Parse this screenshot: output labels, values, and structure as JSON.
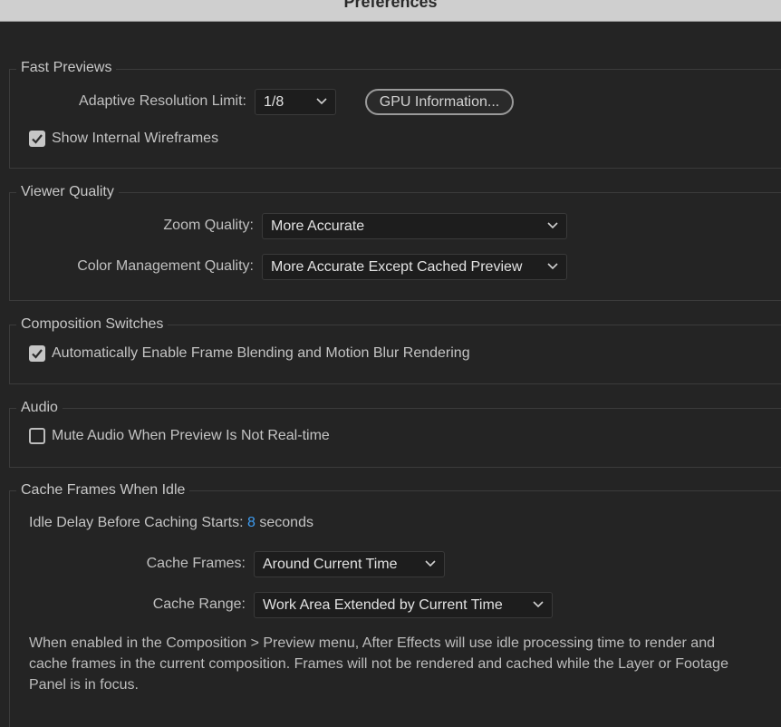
{
  "window": {
    "title": "Preferences"
  },
  "fast_previews": {
    "heading": "Fast Previews",
    "adaptive_label": "Adaptive Resolution Limit:",
    "adaptive_value": "1/8",
    "gpu_button": "GPU Information...",
    "wireframes_label": "Show Internal Wireframes",
    "wireframes_checked": true
  },
  "viewer_quality": {
    "heading": "Viewer Quality",
    "zoom_label": "Zoom Quality:",
    "zoom_value": "More Accurate",
    "color_label": "Color Management Quality:",
    "color_value": "More Accurate Except Cached Preview"
  },
  "composition_switches": {
    "heading": "Composition Switches",
    "frame_blending_label": "Automatically Enable Frame Blending and Motion Blur Rendering",
    "frame_blending_checked": true
  },
  "audio": {
    "heading": "Audio",
    "mute_label": "Mute Audio When Preview Is Not Real-time",
    "mute_checked": false
  },
  "cache_frames": {
    "heading": "Cache Frames When Idle",
    "idle_label": "Idle Delay Before Caching Starts:",
    "idle_value": "8",
    "idle_unit": "seconds",
    "cache_frames_label": "Cache Frames:",
    "cache_frames_value": "Around Current Time",
    "cache_range_label": "Cache Range:",
    "cache_range_value": "Work Area Extended by Current Time",
    "note": "When enabled in the Composition > Preview menu, After Effects will use idle processing time to render and cache frames in the current composition. Frames will not be rendered and cached while the Layer or Footage Panel is in focus."
  },
  "colors": {
    "accent": "#3e9cf0",
    "background": "#242424",
    "field": "#1d1d1d"
  },
  "icons": {
    "dropdown": "chevron-down-icon",
    "check": "checkmark-icon"
  }
}
